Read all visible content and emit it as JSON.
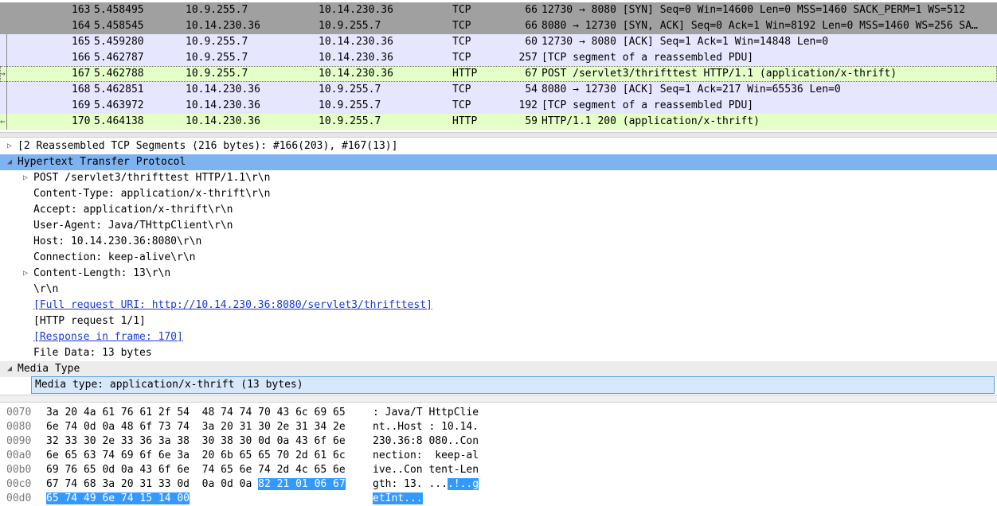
{
  "packets": [
    {
      "no": "163",
      "time": "5.458495",
      "src": "10.9.255.7",
      "dst": "10.14.230.36",
      "proto": "TCP",
      "len": "66",
      "info": "12730 → 8080 [SYN] Seq=0 Win=14600 Len=0 MSS=1460 SACK_PERM=1 WS=512",
      "bg": "#a0a0a0",
      "color": "#000000"
    },
    {
      "no": "164",
      "time": "5.458545",
      "src": "10.14.230.36",
      "dst": "10.9.255.7",
      "proto": "TCP",
      "len": "66",
      "info": "8080 → 12730 [SYN, ACK] Seq=0 Ack=1 Win=8192 Len=0 MSS=1460 WS=256 SA…",
      "bg": "#a0a0a0",
      "color": "#000000"
    },
    {
      "no": "165",
      "time": "5.459280",
      "src": "10.9.255.7",
      "dst": "10.14.230.36",
      "proto": "TCP",
      "len": "60",
      "info": "12730 → 8080 [ACK] Seq=1 Ack=1 Win=14848 Len=0",
      "bg": "#e7e6ff",
      "color": "#000000"
    },
    {
      "no": "166",
      "time": "5.462787",
      "src": "10.9.255.7",
      "dst": "10.14.230.36",
      "proto": "TCP",
      "len": "257",
      "info": "[TCP segment of a reassembled PDU]",
      "bg": "#e7e6ff",
      "color": "#000000"
    },
    {
      "no": "167",
      "time": "5.462788",
      "src": "10.9.255.7",
      "dst": "10.14.230.36",
      "proto": "HTTP",
      "len": "67",
      "info": "POST /servlet3/thrifttest HTTP/1.1  (application/x-thrift)",
      "bg": "#e4ffc7",
      "color": "#000000",
      "selected": true
    },
    {
      "no": "168",
      "time": "5.462851",
      "src": "10.14.230.36",
      "dst": "10.9.255.7",
      "proto": "TCP",
      "len": "54",
      "info": "8080 → 12730 [ACK] Seq=1 Ack=217 Win=65536 Len=0",
      "bg": "#e7e6ff",
      "color": "#000000"
    },
    {
      "no": "169",
      "time": "5.463972",
      "src": "10.14.230.36",
      "dst": "10.9.255.7",
      "proto": "TCP",
      "len": "192",
      "info": "[TCP segment of a reassembled PDU]",
      "bg": "#e7e6ff",
      "color": "#000000"
    },
    {
      "no": "170",
      "time": "5.464138",
      "src": "10.14.230.36",
      "dst": "10.9.255.7",
      "proto": "HTTP",
      "len": "59",
      "info": "HTTP/1.1 200   (application/x-thrift)",
      "bg": "#e4ffc7",
      "color": "#000000"
    }
  ],
  "details": [
    {
      "arrow": "right",
      "text": "[2 Reassembled TCP Segments (216 bytes): #166(203), #167(13)]",
      "indent": 0
    },
    {
      "arrow": "down",
      "text": "Hypertext Transfer Protocol",
      "indent": 0,
      "highlight": true
    },
    {
      "arrow": "right",
      "text": "POST /servlet3/thrifttest HTTP/1.1\\r\\n",
      "indent": 1
    },
    {
      "arrow": "",
      "text": "Content-Type: application/x-thrift\\r\\n",
      "indent": 1
    },
    {
      "arrow": "",
      "text": "Accept: application/x-thrift\\r\\n",
      "indent": 1
    },
    {
      "arrow": "",
      "text": "User-Agent: Java/THttpClient\\r\\n",
      "indent": 1
    },
    {
      "arrow": "",
      "text": "Host: 10.14.230.36:8080\\r\\n",
      "indent": 1
    },
    {
      "arrow": "",
      "text": "Connection: keep-alive\\r\\n",
      "indent": 1
    },
    {
      "arrow": "right",
      "text": "Content-Length: 13\\r\\n",
      "indent": 1
    },
    {
      "arrow": "",
      "text": "\\r\\n",
      "indent": 1
    },
    {
      "arrow": "",
      "text": "[Full request URI: http://10.14.230.36:8080/servlet3/thrifttest]",
      "indent": 1,
      "link": true
    },
    {
      "arrow": "",
      "text": "[HTTP request 1/1]",
      "indent": 1
    },
    {
      "arrow": "",
      "text": "[Response in frame: 170]",
      "indent": 1,
      "link": true
    },
    {
      "arrow": "",
      "text": "File Data: 13 bytes",
      "indent": 1
    },
    {
      "arrow": "down",
      "text": "Media Type",
      "indent": 0,
      "section": true
    },
    {
      "arrow": "",
      "text": "Media type: application/x-thrift (13 bytes)",
      "indent": 1,
      "boxed": true
    }
  ],
  "hex": [
    {
      "offset": "0070",
      "bytes1": "3a 20 4a 61 76 61 2f 54",
      "bytes2": "48 74 74 70 43 6c 69 65",
      "ascii1": ": Java/T",
      "ascii2": "HttpClie"
    },
    {
      "offset": "0080",
      "bytes1": "6e 74 0d 0a 48 6f 73 74",
      "bytes2": "3a 20 31 30 2e 31 34 2e",
      "ascii1": "nt..Host",
      "ascii2": ": 10.14."
    },
    {
      "offset": "0090",
      "bytes1": "32 33 30 2e 33 36 3a 38",
      "bytes2": "30 38 30 0d 0a 43 6f 6e",
      "ascii1": "230.36:8",
      "ascii2": "080..Con"
    },
    {
      "offset": "00a0",
      "bytes1": "6e 65 63 74 69 6f 6e 3a",
      "bytes2": "20 6b 65 65 70 2d 61 6c",
      "ascii1": "nection:",
      "ascii2": " keep-al"
    },
    {
      "offset": "00b0",
      "bytes1": "69 76 65 0d 0a 43 6f 6e",
      "bytes2": "74 65 6e 74 2d 4c 65 6e",
      "ascii1": "ive..Con",
      "ascii2": "tent-Len"
    },
    {
      "offset": "00c0",
      "bytes1": "67 74 68 3a 20 31 33 0d",
      "bytes2": "0a 0d 0a",
      "bytes2sel": "82 21 01 06 67",
      "ascii1": "gth: 13.",
      "ascii2": "...",
      "ascii2sel": ".!..g"
    },
    {
      "offset": "00d0",
      "bytes1sel": "65 74 49 6e 74 15 14 00",
      "ascii1sel": "etInt..."
    }
  ]
}
